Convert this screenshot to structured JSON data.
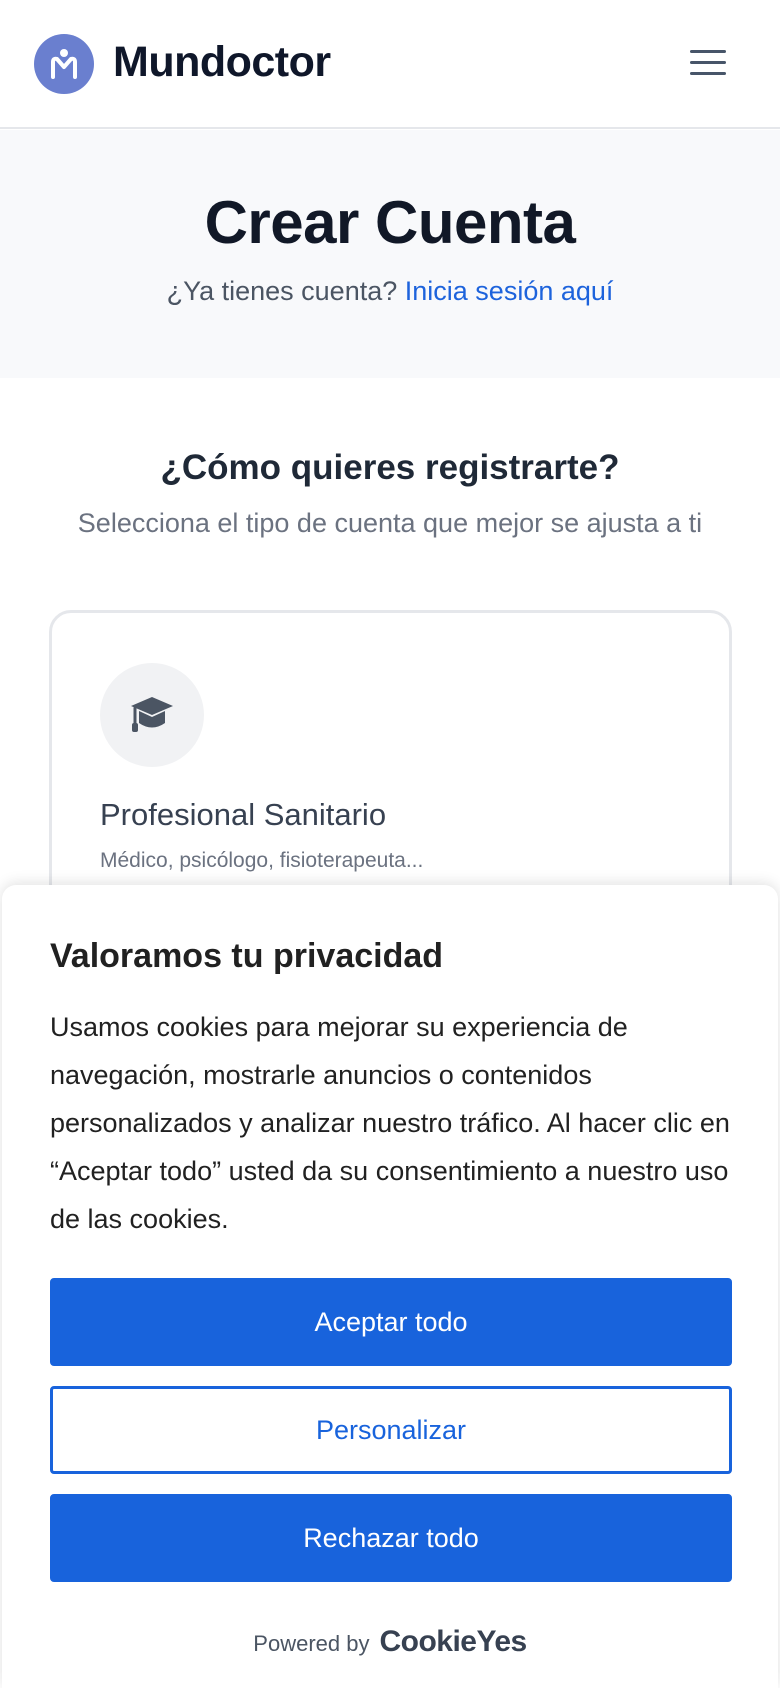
{
  "header": {
    "brand": "Mundoctor",
    "logo_icon": "mundoctor-logo-icon",
    "menu_icon": "hamburger-menu-icon"
  },
  "hero": {
    "title": "Crear Cuenta",
    "prompt": "¿Ya tienes cuenta?",
    "login_link": "Inicia sesión aquí"
  },
  "registration": {
    "title": "¿Cómo quieres registrarte?",
    "subtitle": "Selecciona el tipo de cuenta que mejor se ajusta a ti",
    "options": [
      {
        "icon": "graduation-cap-icon",
        "title": "Profesional Sanitario",
        "description": "Médico, psicólogo, fisioterapeuta..."
      }
    ]
  },
  "cookie_banner": {
    "title": "Valoramos tu privacidad",
    "text": "Usamos cookies para mejorar su experiencia de navegación, mostrarle anuncios o contenidos personalizados y analizar nuestro tráfico. Al hacer clic en “Aceptar todo” usted da su consentimiento a nuestro uso de las cookies.",
    "accept_label": "Aceptar todo",
    "customize_label": "Personalizar",
    "reject_label": "Rechazar todo",
    "powered_by": "Powered by",
    "provider": "CookieYes"
  },
  "colors": {
    "brand_logo": "#6a7fcf",
    "link": "#1d63dc",
    "button_primary": "#1863dc",
    "hero_bg": "#f8f9fb"
  }
}
